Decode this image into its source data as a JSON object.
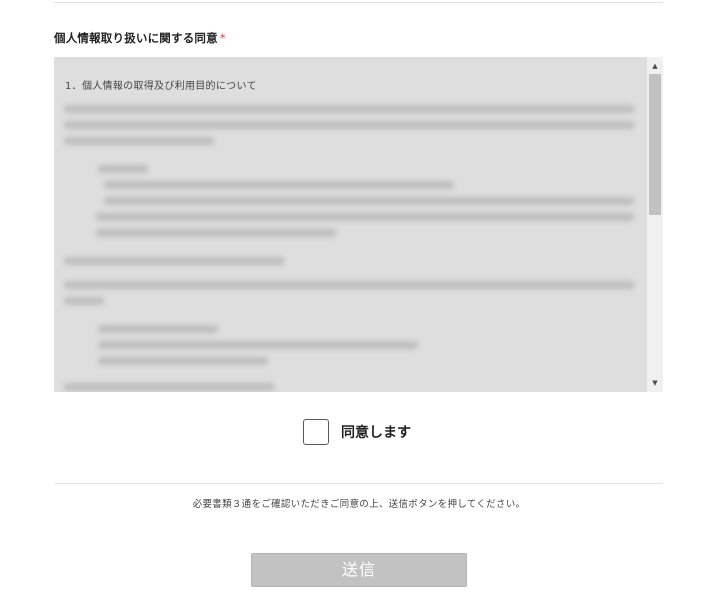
{
  "consent_section": {
    "title": "個人情報取り扱いに関する同意",
    "required_mark": "*"
  },
  "terms": {
    "heading": "1．個人情報の取得及び利用目的について",
    "body_state": "blurred"
  },
  "agree_checkbox": {
    "label": "同意します",
    "checked": false
  },
  "notice": "必要書類３通をご確認いただきご同意の上、送信ボタンを押してください。",
  "submit_button": {
    "label": "送信",
    "enabled": false
  },
  "colors": {
    "required": "#e0393e",
    "terms_background": "#dedede",
    "button_disabled": "#c2c2c2"
  },
  "icons": {
    "scroll_up": "triangle-up-icon",
    "scroll_down": "triangle-down-icon"
  }
}
